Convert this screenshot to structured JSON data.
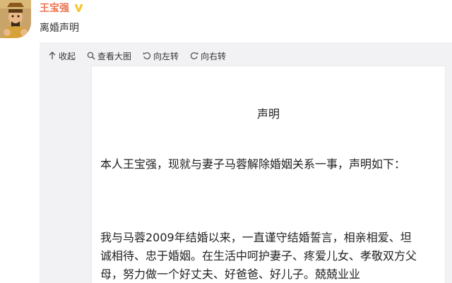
{
  "post": {
    "username": "王宝强",
    "text": "离婚声明"
  },
  "toolbar": {
    "collapse_label": "收起",
    "view_large_label": "查看大图",
    "rotate_left_label": "向左转",
    "rotate_right_label": "向右转"
  },
  "document": {
    "title": "声明",
    "paragraphs": [
      "本人王宝强，现就与妻子马蓉解除婚姻关系一事，声明如下：",
      "我与马蓉2009年结婚以来，一直谨守结婚誓言，相亲相爱、坦诚相待、忠于婚姻。在生活中呵护妻子、疼爱儿女、孝敬双方父母，努力做一个好丈夫、好爸爸、好儿子。兢兢业业"
    ]
  },
  "colors": {
    "username": "#eb7350",
    "verified_badge": "#f9c52f",
    "media_background": "#f2f2f5"
  },
  "icons": {
    "verified": "verified-badge-icon",
    "collapse": "arrow-up-icon",
    "view_large": "magnify-icon",
    "rotate_left": "rotate-left-icon",
    "rotate_right": "rotate-right-icon"
  }
}
